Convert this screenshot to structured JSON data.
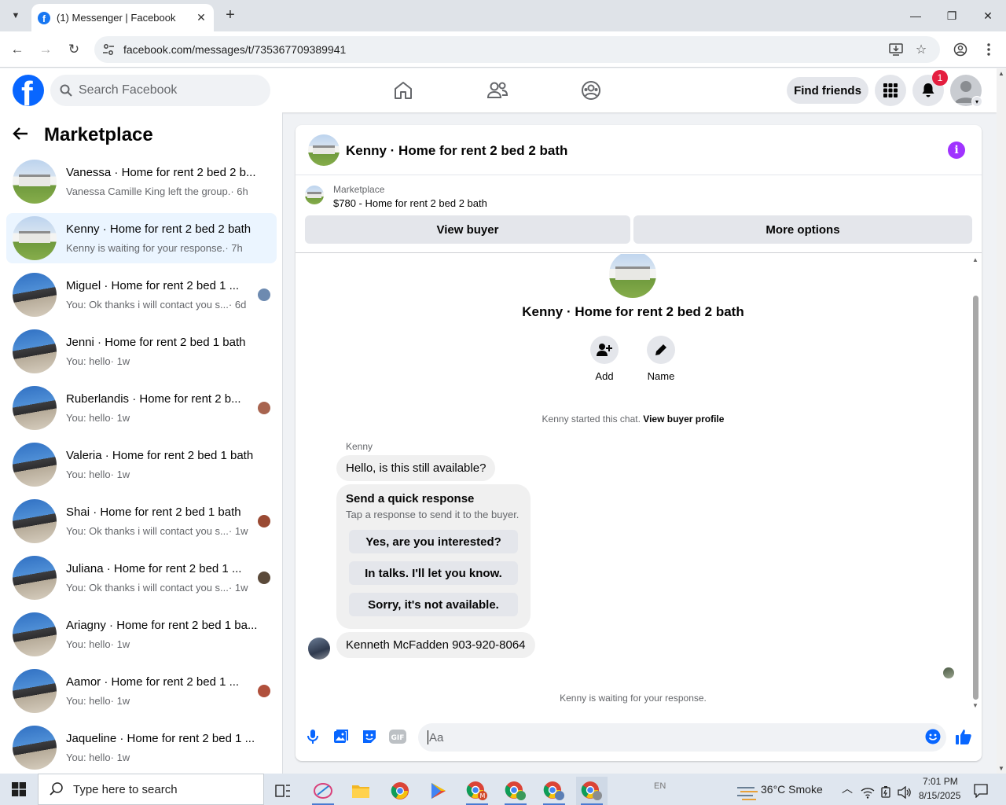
{
  "browser": {
    "tab_title": "(1) Messenger | Facebook",
    "url": "facebook.com/messages/t/735367709389941"
  },
  "header": {
    "search_placeholder": "Search Facebook",
    "find_friends": "Find friends",
    "notification_count": "1"
  },
  "sidebar": {
    "title": "Marketplace",
    "conversations": [
      {
        "title": "Vanessa · Home for rent 2 bed 2 b...",
        "subtitle": "Vanessa Camille King left the group.",
        "time": "· 6h",
        "thumb": "house",
        "active": false
      },
      {
        "title": "Kenny · Home for rent 2 bed 2 bath",
        "subtitle": "Kenny is waiting for your response.",
        "time": "· 7h",
        "thumb": "house",
        "active": true
      },
      {
        "title": "Miguel · Home for rent 2 bed 1 ...",
        "subtitle": "You: Ok thanks i will contact you s...",
        "time": "· 6d",
        "thumb": "street",
        "seen": "#6d8ab0"
      },
      {
        "title": "Jenni · Home for rent 2 bed 1 bath",
        "subtitle": "You: hello",
        "time": "· 1w",
        "thumb": "street"
      },
      {
        "title": "Ruberlandis · Home for rent 2 b...",
        "subtitle": "You: hello",
        "time": "· 1w",
        "thumb": "street",
        "seen": "#a8644f"
      },
      {
        "title": "Valeria · Home for rent 2 bed 1 bath",
        "subtitle": "You: hello",
        "time": "· 1w",
        "thumb": "street"
      },
      {
        "title": "Shai · Home for rent 2 bed 1 bath",
        "subtitle": "You: Ok thanks i will contact you s...",
        "time": "· 1w",
        "thumb": "street",
        "seen": "#9a4a33"
      },
      {
        "title": "Juliana · Home for rent 2 bed 1 ...",
        "subtitle": "You: Ok thanks i will contact you s...",
        "time": "· 1w",
        "thumb": "street",
        "seen": "#5b4a3a"
      },
      {
        "title": "Ariagny · Home for rent 2 bed 1 ba...",
        "subtitle": "You: hello",
        "time": "· 1w",
        "thumb": "street"
      },
      {
        "title": "Aamor · Home for rent 2 bed 1 ...",
        "subtitle": "You: hello",
        "time": "· 1w",
        "thumb": "street",
        "seen": "#b0503c"
      },
      {
        "title": "Jaqueline · Home for rent 2 bed 1 ...",
        "subtitle": "You: hello",
        "time": "· 1w",
        "thumb": "street"
      }
    ]
  },
  "chat": {
    "title": "Kenny · Home for rent 2 bed 2 bath",
    "marketplace_label": "Marketplace",
    "item": "$780 - Home for rent 2 bed 2 bath",
    "view_buyer": "View buyer",
    "more_options": "More options",
    "add_label": "Add",
    "name_label": "Name",
    "started_text": "Kenny started this chat.",
    "view_buyer_profile": "View buyer profile",
    "sender": "Kenny",
    "message1": "Hello, is this still available?",
    "quick_title": "Send a quick response",
    "quick_sub": "Tap a response to send it to the buyer.",
    "quick_replies": [
      "Yes, are you interested?",
      "In talks. I'll let you know.",
      "Sorry, it's not available."
    ],
    "message2": "Kenneth McFadden 903-920-8064",
    "waiting": "Kenny is waiting for your response.",
    "composer_placeholder": "Aa"
  },
  "taskbar": {
    "search_placeholder": "Type here to search",
    "lang": "EN",
    "weather": "36°C  Smoke",
    "time": "7:01 PM",
    "date": "8/15/2025"
  },
  "colors": {
    "fb_blue": "#0866ff",
    "messenger_purple": "#a033ff",
    "badge_red": "#e41e3f"
  }
}
